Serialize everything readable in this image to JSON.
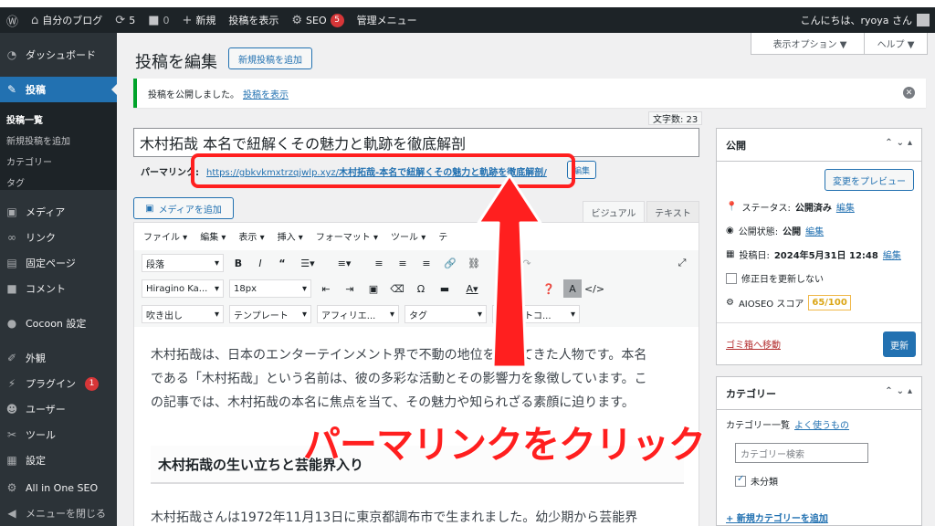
{
  "adminbar": {
    "site_name": "自分のブログ",
    "updates_count": "5",
    "comments_count": "0",
    "new_label": "新規",
    "view_post": "投稿を表示",
    "seo_label": "SEO",
    "seo_badge": "5",
    "admin_menu": "管理メニュー",
    "greeting": "こんにちは、ryoya さん"
  },
  "sidebar": {
    "dashboard": "ダッシュボード",
    "posts": "投稿",
    "sub_all": "投稿一覧",
    "sub_new": "新規投稿を追加",
    "sub_categories": "カテゴリー",
    "sub_tags": "タグ",
    "media": "メディア",
    "links": "リンク",
    "pages": "固定ページ",
    "comments": "コメント",
    "cocoon": "Cocoon 設定",
    "appearance": "外観",
    "plugins": "プラグイン",
    "plugins_badge": "1",
    "users": "ユーザー",
    "tools": "ツール",
    "settings": "設定",
    "aioseo": "All in One SEO",
    "collapse": "メニューを閉じる"
  },
  "screen_options": "表示オプション ▼",
  "help": "ヘルプ ▼",
  "page": {
    "title": "投稿を編集",
    "add_new": "新規投稿を追加",
    "notice_text": "投稿を公開しました。",
    "notice_link": "投稿を表示",
    "word_count": "文字数: 23",
    "post_title": "木村拓哉 本名で紐解くその魅力と軌跡を徹底解剖",
    "permalink_label": "パーマリンク:",
    "permalink_base": "https://gbkvkmxtrzqjwlp.xyz/",
    "permalink_slug": "木村拓哉-本名で紐解くその魅力と軌跡を徹底解剖/",
    "edit_slug": "編集"
  },
  "editor": {
    "add_media": "メディアを追加",
    "tab_visual": "ビジュアル",
    "tab_text": "テキスト",
    "menu": [
      "ファイル ▾",
      "編集 ▾",
      "表示 ▾",
      "挿入 ▾",
      "フォーマット ▾",
      "ツール ▾",
      "テ"
    ],
    "format_select": "段落",
    "font_select": "Hiragino Ka...",
    "size_select": "18px",
    "balloon_select": "吹き出し",
    "template_select": "テンプレート",
    "affiliate_select": "アフィリエ...",
    "tag_select": "タグ",
    "shortcode_select": "ショートコ...",
    "paragraph1_line1": "木村拓哉は、日本のエンターテインメント界で不動の地位を築いてきた人物です。本名",
    "paragraph1_line2": "である「木村拓哉」という名前は、彼の多彩な活動とその影響力を象徴しています。こ",
    "paragraph1_line3": "の記事では、木村拓哉の本名に焦点を当て、その魅力や知られざる素顔に迫ります。",
    "heading": "木村拓哉の生い立ちと芸能界入り",
    "paragraph2_line1": "木村拓哉さんは1972年11月13日に東京都調布市で生まれました。幼少期から芸能界"
  },
  "publish": {
    "title": "公開",
    "preview": "変更をプレビュー",
    "status_label": "ステータス:",
    "status_value": "公開済み",
    "visibility_label": "公開状態:",
    "visibility_value": "公開",
    "date_label": "投稿日:",
    "date_value": "2024年5月31日 12:48",
    "edit": "編集",
    "modified_label": "修正日を更新しない",
    "aioseo_label": "AIOSEO スコア",
    "aioseo_score": "65/100",
    "trash": "ゴミ箱へ移動",
    "update": "更新"
  },
  "categories": {
    "title": "カテゴリー",
    "tab_all": "カテゴリー一覧",
    "tab_popular": "よく使うもの",
    "search_placeholder": "カテゴリー検索",
    "item": "未分類",
    "add_new": "+ 新規カテゴリーを追加"
  },
  "overlay": {
    "caption": "パーマリンクをクリック"
  },
  "colors": {
    "annotation": "#ff1f1f",
    "accent": "#2271b1",
    "sidebar": "#2c3338",
    "adminbar": "#1d2327"
  }
}
